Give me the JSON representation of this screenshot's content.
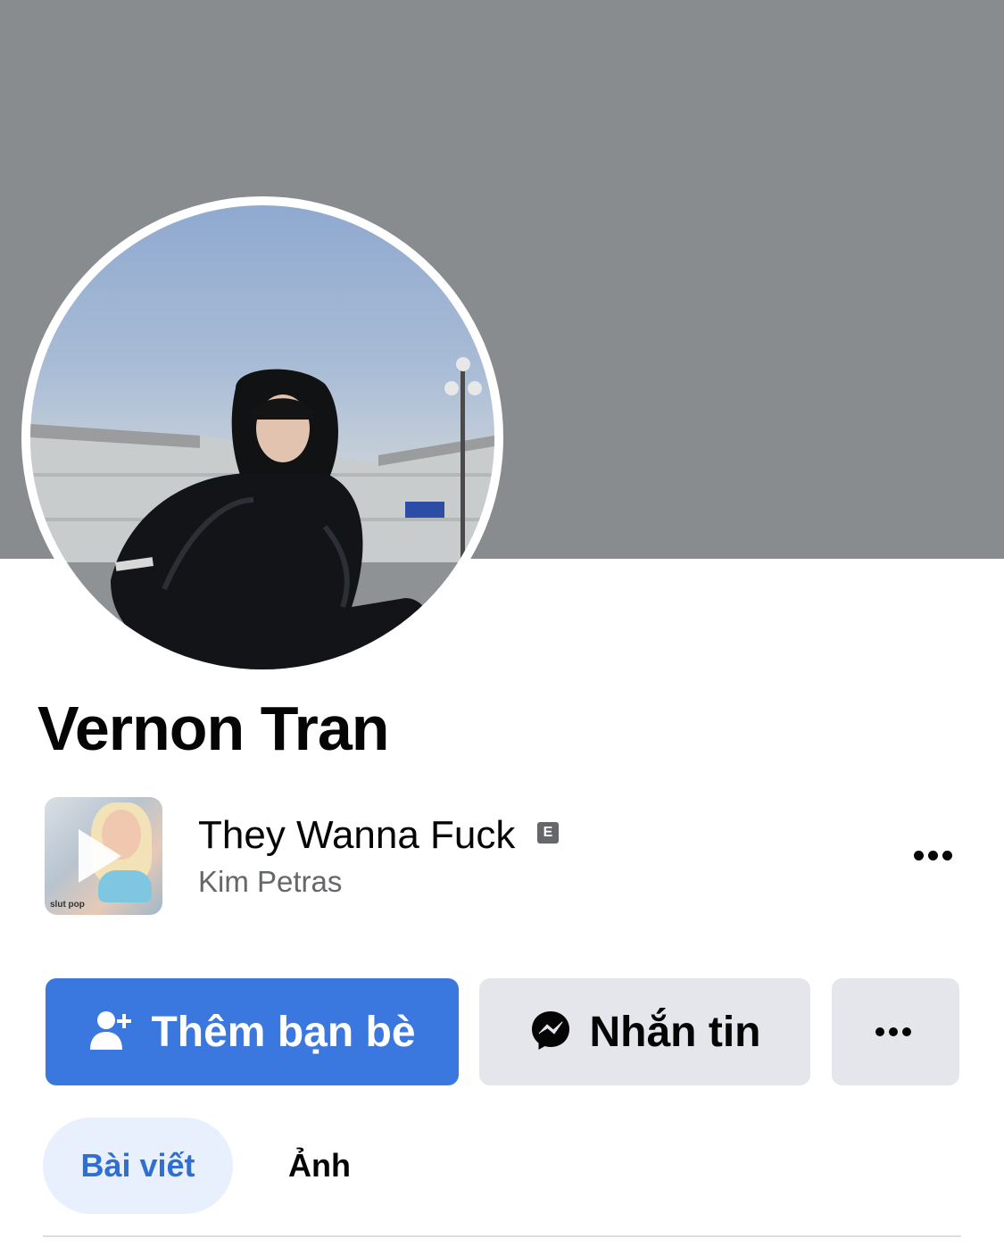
{
  "profile": {
    "name": "Vernon Tran"
  },
  "music": {
    "title": "They Wanna Fuck",
    "explicit": "E",
    "artist": "Kim Petras",
    "album_art_text": "slut pop"
  },
  "actions": {
    "add_friend_label": "Thêm bạn bè",
    "message_label": "Nhắn tin"
  },
  "tabs": [
    {
      "label": "Bài viết",
      "active": true
    },
    {
      "label": "Ảnh",
      "active": false
    }
  ],
  "colors": {
    "accent": "#3a77de",
    "cover": "#898c8f",
    "active_tab_bg": "#e7f0fc",
    "active_tab_text": "#2e6fd1"
  },
  "icons": [
    "add-friend-icon",
    "messenger-icon",
    "more-icon",
    "play-icon"
  ]
}
